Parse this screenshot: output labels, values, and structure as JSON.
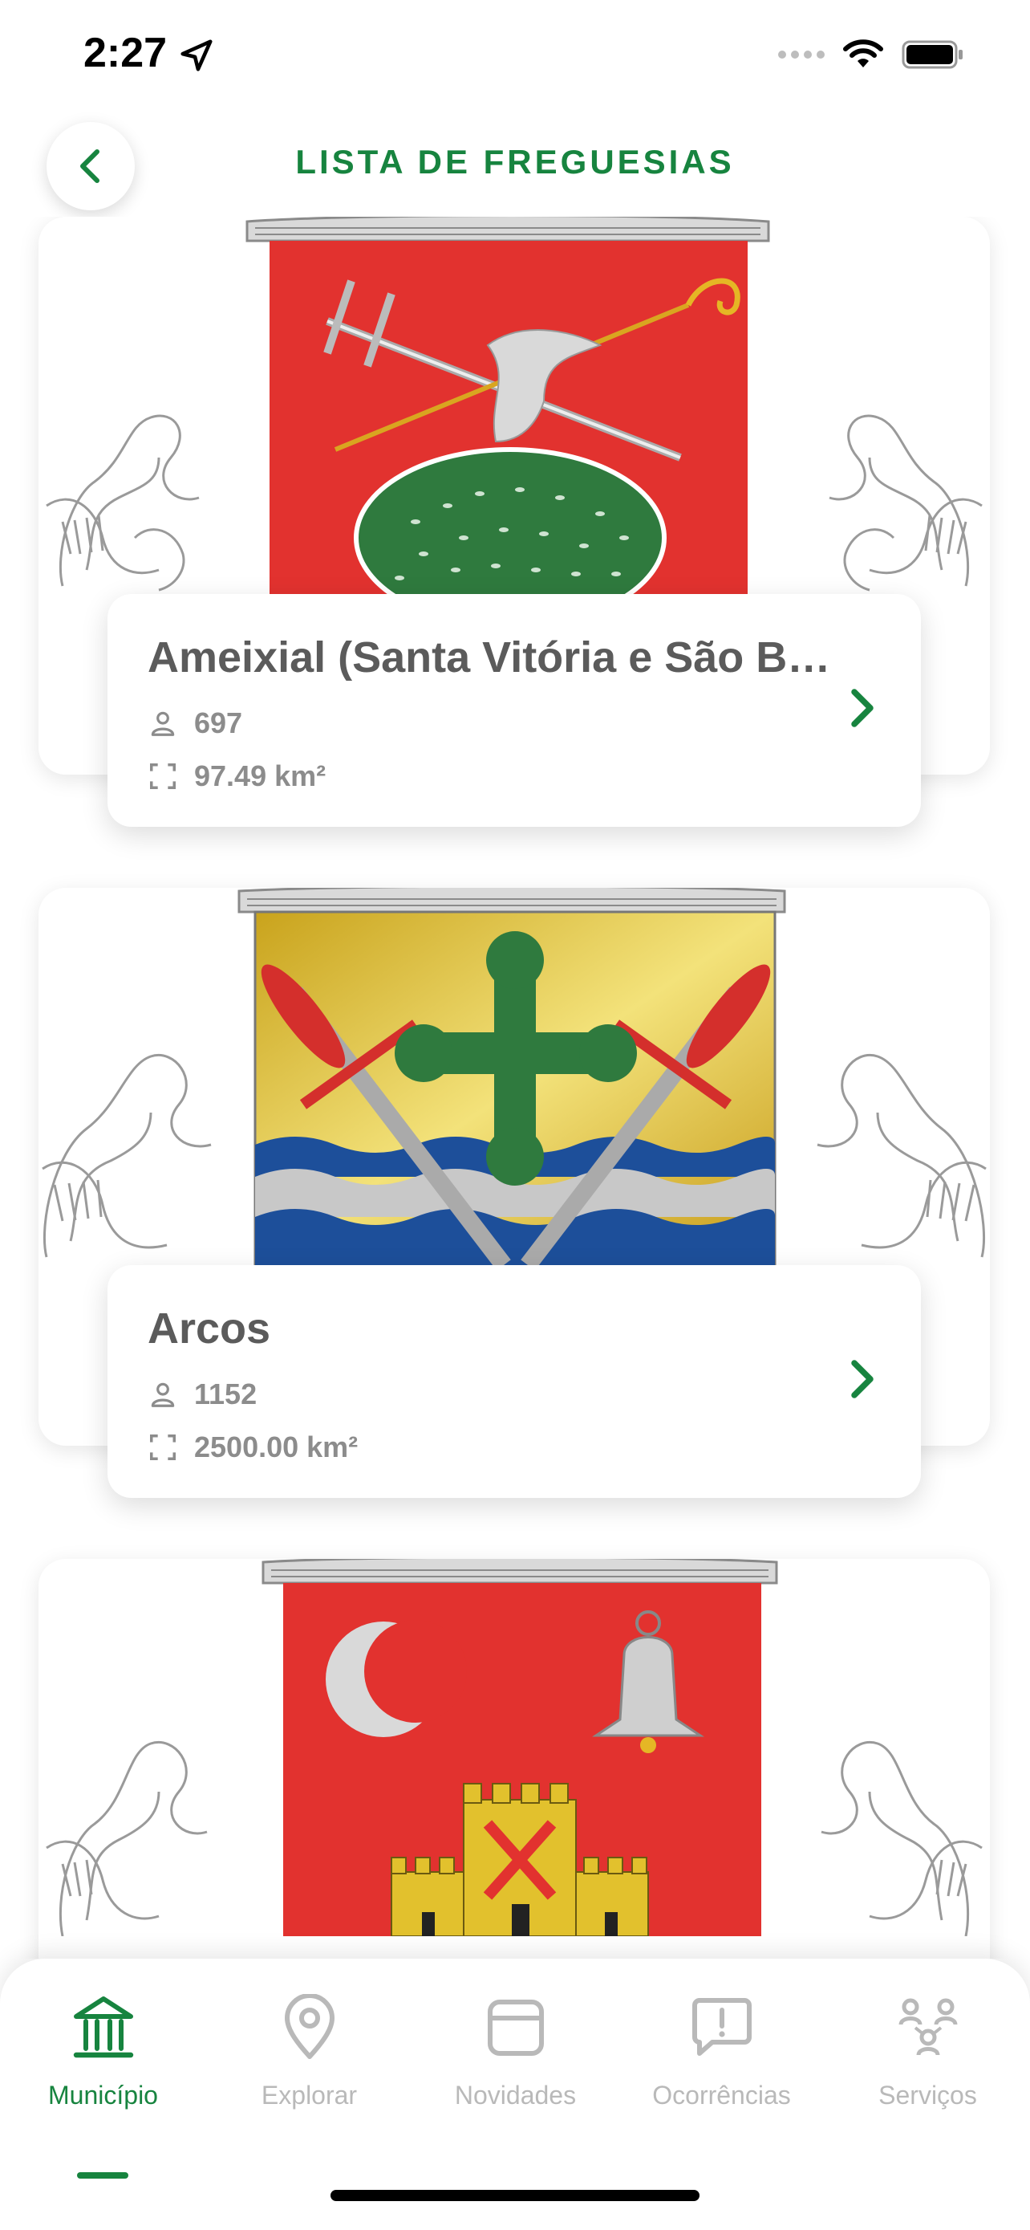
{
  "status_bar": {
    "time": "2:27",
    "location_icon": "location-arrow-icon",
    "signal_icon": "signal-dots-icon",
    "wifi_icon": "wifi-icon",
    "battery_icon": "battery-icon"
  },
  "header": {
    "back_icon": "chevron-left-icon",
    "title": "LISTA DE FREGUESIAS"
  },
  "colors": {
    "brand_green": "#17843f",
    "text_dark": "#5b5b5b",
    "text_muted": "#8c8c8c",
    "tab_inactive": "#b9b9b9"
  },
  "freguesias": [
    {
      "name": "Ameixial (Santa Vitória e São Bento)",
      "population": "697",
      "area": "97.49 km²",
      "population_icon": "person-icon",
      "area_icon": "area-frame-icon",
      "chevron_icon": "chevron-right-icon",
      "image_icon": "coat-of-arms-icon"
    },
    {
      "name": "Arcos",
      "population": "1152",
      "area": "2500.00 km²",
      "population_icon": "person-icon",
      "area_icon": "area-frame-icon",
      "chevron_icon": "chevron-right-icon",
      "image_icon": "coat-of-arms-icon"
    },
    {
      "name": "",
      "image_icon": "coat-of-arms-icon"
    }
  ],
  "tabs": [
    {
      "label": "Município",
      "icon": "municipality-building-icon",
      "active": true
    },
    {
      "label": "Explorar",
      "icon": "map-pin-icon",
      "active": false
    },
    {
      "label": "Novidades",
      "icon": "news-card-icon",
      "active": false
    },
    {
      "label": "Ocorrências",
      "icon": "alert-bubble-icon",
      "active": false
    },
    {
      "label": "Serviços",
      "icon": "people-network-icon",
      "active": false
    }
  ]
}
